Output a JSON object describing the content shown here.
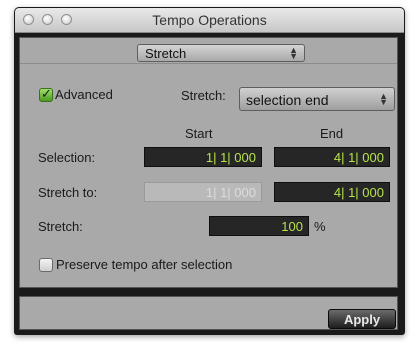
{
  "window": {
    "title": "Tempo Operations"
  },
  "operation_popup": {
    "value": "Stretch"
  },
  "advanced": {
    "label": "Advanced",
    "checked": true
  },
  "stretch_mode": {
    "label": "Stretch:",
    "value": "selection end"
  },
  "columns": {
    "start": "Start",
    "end": "End"
  },
  "rows": {
    "selection": {
      "label": "Selection:",
      "start": "1| 1| 000",
      "end": "4| 1| 000"
    },
    "stretch_to": {
      "label": "Stretch to:",
      "start": "1| 1| 000",
      "end": "4| 1| 000"
    }
  },
  "stretch_percent": {
    "label": "Stretch:",
    "value": "100",
    "unit": "%"
  },
  "preserve_tempo": {
    "label": "Preserve tempo after selection",
    "checked": false
  },
  "apply": {
    "label": "Apply"
  },
  "colors": {
    "field_text": "#b7e24a",
    "field_bg": "#262626",
    "check_green": "#4a9a1e"
  }
}
